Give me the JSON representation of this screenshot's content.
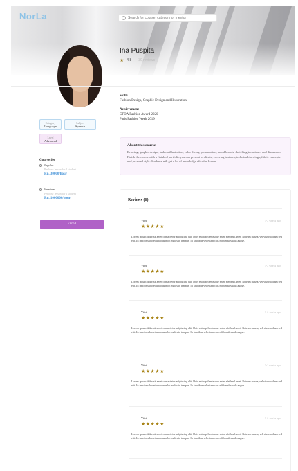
{
  "header": {
    "logo": "NorLa",
    "search_placeholder": "Search for course, category or mentor"
  },
  "profile": {
    "name": "Ina Puspita",
    "rating": "4.8",
    "rating_count": "30 reviews"
  },
  "details": {
    "skills_title": "Skills",
    "skills": "Fashion Design, Graphic Design and Illustration",
    "achievement_title": "Achievement",
    "achievements": [
      "CFDA Fashion Award 2020",
      "Paris Fashion Week 2019"
    ]
  },
  "levels": [
    {
      "label": "Category",
      "value": "Language"
    },
    {
      "label": "Subject",
      "value": "Spanish"
    },
    {
      "label": "Level",
      "value": "Advanced"
    }
  ],
  "course_fee": {
    "title": "Course fee",
    "options": [
      {
        "name": "Regular",
        "note": "Per hour lesson for 1 student",
        "price": "Rp. 30000/hour"
      },
      {
        "name": "Premium",
        "note": "Per hour lesson for 1 student",
        "price": "Rp. 1000000/hour"
      }
    ],
    "enroll_label": "Enroll"
  },
  "about": {
    "title": "About this course",
    "text": "Drawing, graphic design, fashion illustration, color theory, presentation, mood boards, sketching techniques and discussion. Finish the course with a finished portfolio you can present to clients, covering textures, technical drawings, fabric concepts and personal style. Students will get a lot of knowledge after the lesson."
  },
  "reviews": {
    "title": "Reviews (6)",
    "items": [
      {
        "user": "Vitri",
        "time": "3-2 weeks ago",
        "stars": "★★★★★",
        "text": "Lorem ipsum dolor sit amet consectetur adipiscing elit. Duis enim pellentesque enim eleifend amet. Rutrum massa, vel viverra diam sed elit. In faucibus leo etiam cras nibh molestie tempus. In faucibus vel etiam cras nibh malesuada augue."
      },
      {
        "user": "Vitri",
        "time": "3-2 weeks ago",
        "stars": "★★★★★",
        "text": "Lorem ipsum dolor sit amet consectetur adipiscing elit. Duis enim pellentesque enim eleifend amet. Rutrum massa, vel viverra diam sed elit. In faucibus leo etiam cras nibh molestie tempus. In faucibus vel etiam cras nibh malesuada augue."
      },
      {
        "user": "Vitri",
        "time": "3-2 weeks ago",
        "stars": "★★★★★",
        "text": "Lorem ipsum dolor sit amet consectetur adipiscing elit. Duis enim pellentesque enim eleifend amet. Rutrum massa, vel viverra diam sed elit. In faucibus leo etiam cras nibh molestie tempus. In faucibus vel etiam cras nibh malesuada augue."
      },
      {
        "user": "Vitri",
        "time": "3-2 weeks ago",
        "stars": "★★★★★",
        "text": "Lorem ipsum dolor sit amet consectetur adipiscing elit. Duis enim pellentesque enim eleifend amet. Rutrum massa, vel viverra diam sed elit. In faucibus leo etiam cras nibh molestie tempus. In faucibus vel etiam cras nibh malesuada augue."
      },
      {
        "user": "Vitri",
        "time": "3-2 weeks ago",
        "stars": "★★★★★",
        "text": "Lorem ipsum dolor sit amet consectetur adipiscing elit. Duis enim pellentesque enim eleifend amet. Rutrum massa, vel viverra diam sed elit. In faucibus leo etiam cras nibh molestie tempus. In faucibus vel etiam cras nibh malesuada augue."
      }
    ]
  },
  "colors": {
    "accent": "#b061c7",
    "price": "#3e8fd6",
    "star": "#a88417"
  }
}
